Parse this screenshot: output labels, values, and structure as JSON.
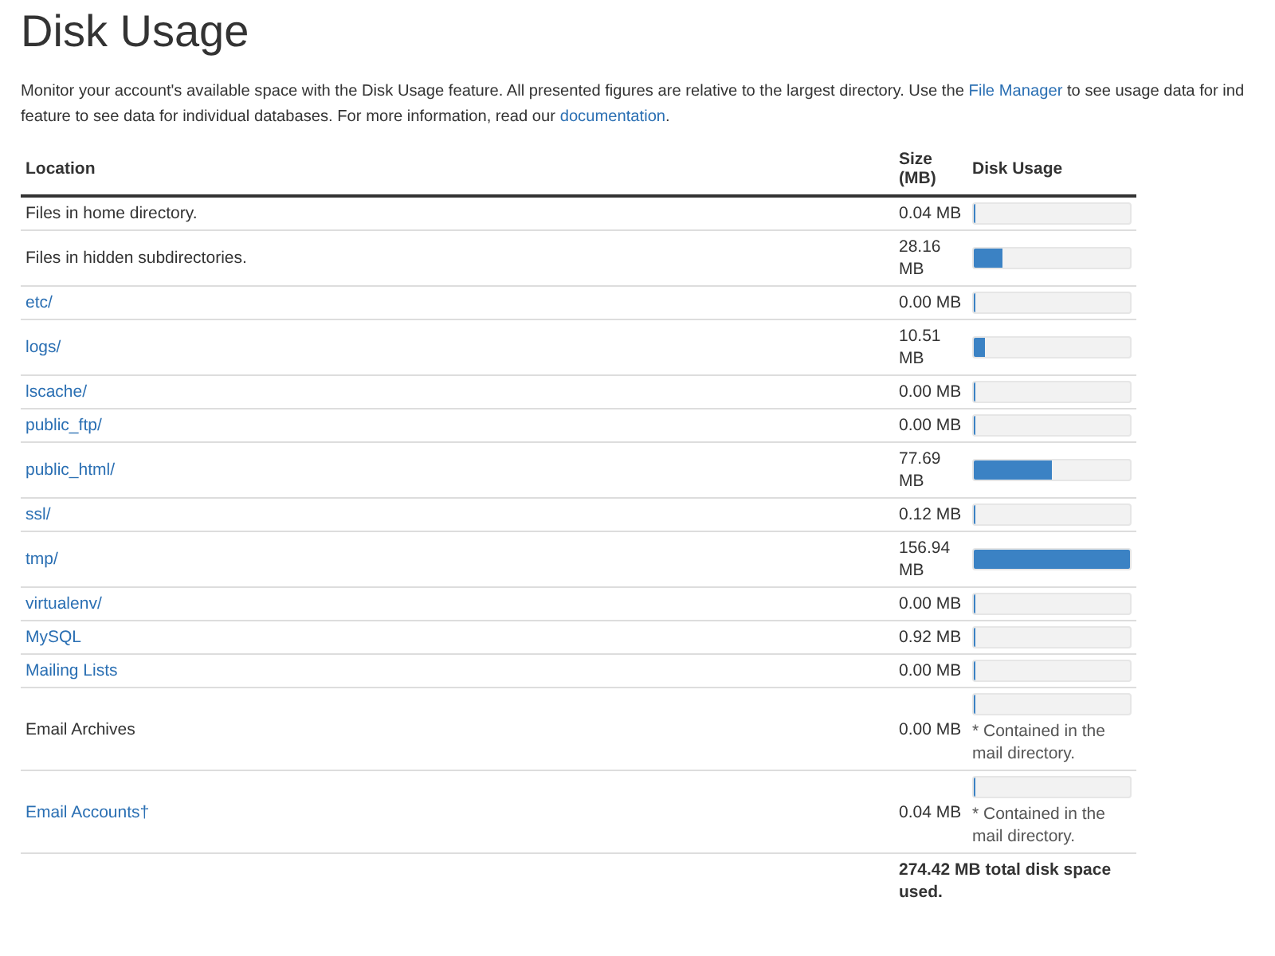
{
  "title": "Disk Usage",
  "intro": [
    [
      {
        "text": "Monitor your account's available space with the Disk Usage feature. All presented figures are relative to the largest directory. Use the "
      },
      {
        "text": "File Manager",
        "link": true
      },
      {
        "text": " to see usage data for ind"
      }
    ],
    [
      {
        "text": "feature to see data for individual databases. For more information, read our "
      },
      {
        "text": "documentation",
        "link": true
      },
      {
        "text": "."
      }
    ]
  ],
  "table": {
    "columns": [
      "Location",
      "Size (MB)",
      "Disk Usage"
    ],
    "rows": [
      {
        "location": "Files in home directory.",
        "link": false,
        "size": "0.04 MB",
        "level": 0.0003
      },
      {
        "location": "Files in hidden subdirectories.",
        "link": false,
        "size": "28.16 MB",
        "level": 0.18
      },
      {
        "location": "etc/",
        "link": true,
        "size": "0.00 MB",
        "level": 0
      },
      {
        "location": "logs/",
        "link": true,
        "size": "10.51 MB",
        "level": 0.067
      },
      {
        "location": "lscache/",
        "link": true,
        "size": "0.00 MB",
        "level": 0
      },
      {
        "location": "public_ftp/",
        "link": true,
        "size": "0.00 MB",
        "level": 0
      },
      {
        "location": "public_html/",
        "link": true,
        "size": "77.69 MB",
        "level": 0.495
      },
      {
        "location": "ssl/",
        "link": true,
        "size": "0.12 MB",
        "level": 0.0008
      },
      {
        "location": "tmp/",
        "link": true,
        "size": "156.94 MB",
        "level": 1
      },
      {
        "location": "virtualenv/",
        "link": true,
        "size": "0.00 MB",
        "level": 0
      },
      {
        "location": "MySQL",
        "link": true,
        "size": "0.92 MB",
        "level": 0.006
      },
      {
        "location": "Mailing Lists",
        "link": true,
        "size": "0.00 MB",
        "level": 0
      },
      {
        "location": "Email Archives",
        "link": false,
        "size": "0.00 MB",
        "level": 0,
        "note": "* Contained in the mail directory."
      },
      {
        "location": "Email Accounts†",
        "link": true,
        "size": "0.04 MB",
        "level": 0.0003,
        "note": "* Contained in the mail directory."
      }
    ],
    "total": "274.42 MB total disk space used."
  }
}
